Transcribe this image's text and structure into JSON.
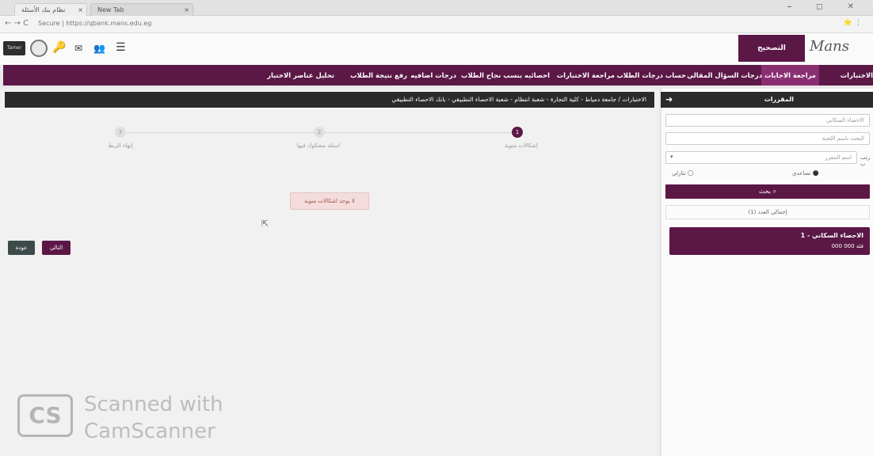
{
  "browser": {
    "tabs": [
      {
        "label": "نظام بنك الأسئلة"
      },
      {
        "label": "New Tab"
      }
    ],
    "url": "Secure | https://qbank.mans.edu.eg",
    "window_controls": "⎯ ◻ ✕"
  },
  "header": {
    "login_label": "Tamer",
    "brand_label": "التصحيح الالكترونى",
    "logo_text": "Mans"
  },
  "main_nav": {
    "items": [
      {
        "label": "الاختبارات"
      },
      {
        "label": "مراجعة الاجابات"
      },
      {
        "label": "درجات السؤال المقالي"
      },
      {
        "label": "حساب درجات الطلاب"
      },
      {
        "label": "مراجعة الاختبارات"
      },
      {
        "label": "احصائيه بنسب نجاح الطلاب"
      },
      {
        "label": "درجات اضافيه"
      },
      {
        "label": "رفع نتيجة الطلاب"
      },
      {
        "label": "تحليل عناصر الاختبار"
      }
    ]
  },
  "sidebar": {
    "title": "المقررات",
    "inputs": [
      {
        "placeholder": "الاحصاء السكاني"
      },
      {
        "placeholder": "البحث باسم اللجنة"
      }
    ],
    "sort_label": "رتب ب",
    "sort_value": "اسم المقرر",
    "radio_options": [
      {
        "label": "تصاعدي"
      },
      {
        "label": "تنازلي"
      }
    ],
    "search_button": "بحث",
    "total_count": "إجمالي العدد (1)",
    "result": {
      "title": "1 - الاحصاء السكاني",
      "subtitle": "فئة 000 000"
    }
  },
  "main": {
    "breadcrumb": "الاختبارات / جامعة دمياط - كلية التجارة - شعبة انتظام - شعبة الاحصاء التطبيقي - بانك الاحصاء التطبيقي",
    "steps": [
      {
        "number": "1",
        "label": "إشكالات منوية"
      },
      {
        "number": "2",
        "label": "اسئلة مشكوك فيها"
      },
      {
        "number": "3",
        "label": "إنهاء الربط"
      }
    ],
    "alert": "لا يوجد اشكالات منوية",
    "next_button": "التالي",
    "back_button": "عودة"
  },
  "watermark": {
    "logo": "CS",
    "line1": "Scanned with",
    "line2": "CamScanner"
  },
  "colors": {
    "brand": "#5b1846",
    "brand_active": "#8a2e72",
    "dark_bar": "#2b2b2b"
  }
}
